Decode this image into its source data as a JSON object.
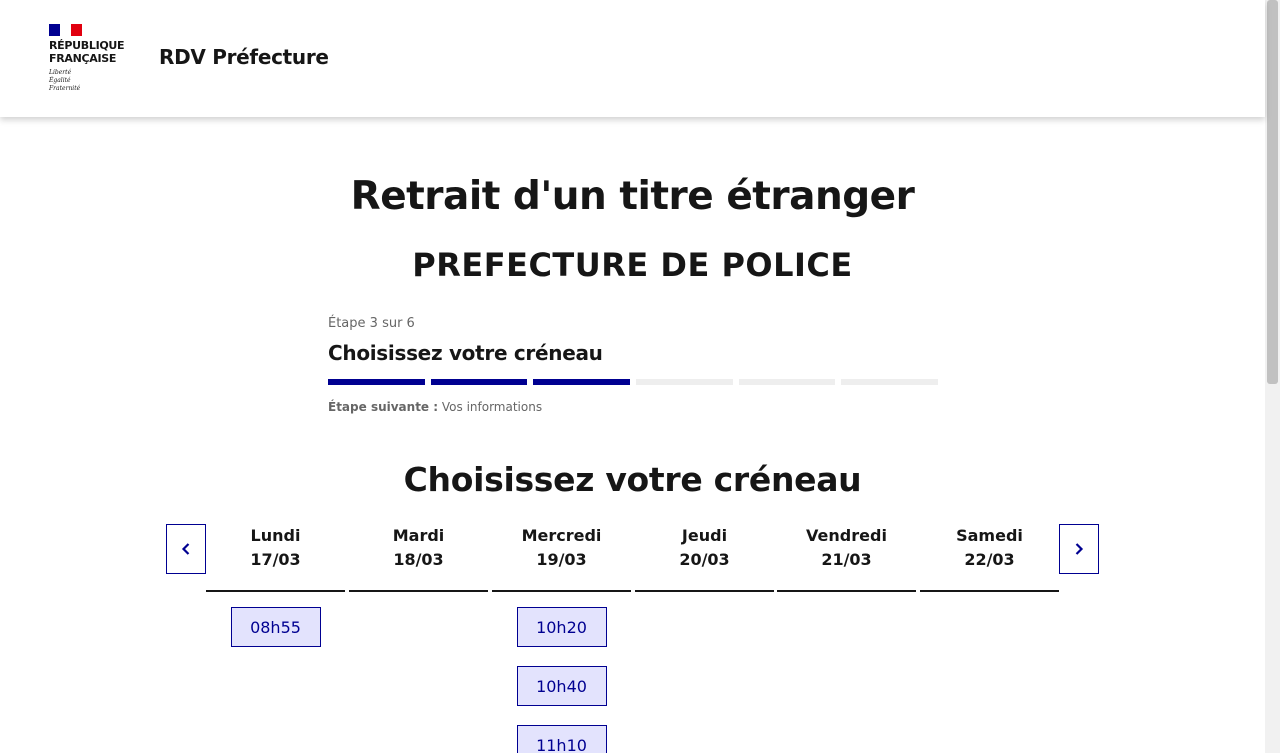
{
  "header": {
    "logo_line1": "RÉPUBLIQUE",
    "logo_line2": "FRANÇAISE",
    "motto_1": "Liberté",
    "motto_2": "Égalité",
    "motto_3": "Fraternité",
    "service_name": "RDV Préfecture"
  },
  "page": {
    "title": "Retrait d'un titre étranger",
    "subtitle": "PREFECTURE DE POLICE"
  },
  "stepper": {
    "state": "Étape 3 sur 6",
    "title": "Choisissez votre créneau",
    "current_step": 3,
    "total_steps": 6,
    "next_label": "Étape suivante :",
    "next_value": "Vos informations"
  },
  "calendar": {
    "title": "Choisissez votre créneau",
    "prev_icon": "chevron-left-icon",
    "next_icon": "chevron-right-icon",
    "days": [
      {
        "name": "Lundi",
        "date": "17/03",
        "slots": [
          "08h55"
        ]
      },
      {
        "name": "Mardi",
        "date": "18/03",
        "slots": []
      },
      {
        "name": "Mercredi",
        "date": "19/03",
        "slots": [
          "10h20",
          "10h40",
          "11h10"
        ]
      },
      {
        "name": "Jeudi",
        "date": "20/03",
        "slots": []
      },
      {
        "name": "Vendredi",
        "date": "21/03",
        "slots": []
      },
      {
        "name": "Samedi",
        "date": "22/03",
        "slots": []
      }
    ]
  },
  "colors": {
    "primary": "#000091",
    "slot_bg": "#e3e3fd",
    "flag_red": "#e1000f"
  }
}
